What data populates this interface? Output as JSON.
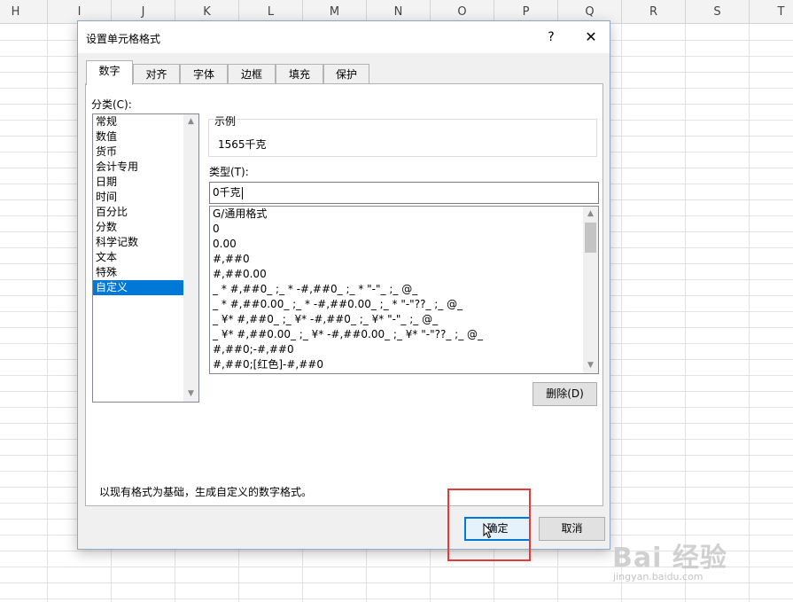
{
  "sheet": {
    "columns": [
      "H",
      "I",
      "J",
      "K",
      "L",
      "M",
      "N",
      "O",
      "P",
      "Q",
      "R",
      "S",
      "T"
    ]
  },
  "dialog": {
    "title": "设置单元格格式",
    "help_label": "?",
    "close_label": "✕",
    "tabs": [
      "数字",
      "对齐",
      "字体",
      "边框",
      "填充",
      "保护"
    ],
    "active_tab": "数字",
    "category_label": "分类(C):",
    "categories": [
      "常规",
      "数值",
      "货币",
      "会计专用",
      "日期",
      "时间",
      "百分比",
      "分数",
      "科学记数",
      "文本",
      "特殊",
      "自定义"
    ],
    "selected_category": "自定义",
    "sample_legend": "示例",
    "sample_value": "1565千克",
    "type_label": "类型(T):",
    "type_value": "0千克",
    "formats": [
      "G/通用格式",
      "0",
      "0.00",
      "#,##0",
      "#,##0.00",
      "_ * #,##0_ ;_ * -#,##0_ ;_ * \"-\"_ ;_ @_",
      "_ * #,##0.00_ ;_ * -#,##0.00_ ;_ * \"-\"??_ ;_ @_",
      "_ ¥* #,##0_ ;_ ¥* -#,##0_ ;_ ¥* \"-\"_ ;_ @_",
      "_ ¥* #,##0.00_ ;_ ¥* -#,##0.00_ ;_ ¥* \"-\"??_ ;_ @_",
      "#,##0;-#,##0",
      "#,##0;[红色]-#,##0"
    ],
    "delete_button": "删除(D)",
    "description": "以现有格式为基础，生成自定义的数字格式。",
    "ok_button": "确定",
    "cancel_button": "取消"
  },
  "watermark": {
    "brand": "Bai 经验",
    "url": "jingyan.baidu.com"
  },
  "colors": {
    "selection": "#0078d7",
    "highlight_box": "#e33b3b"
  }
}
